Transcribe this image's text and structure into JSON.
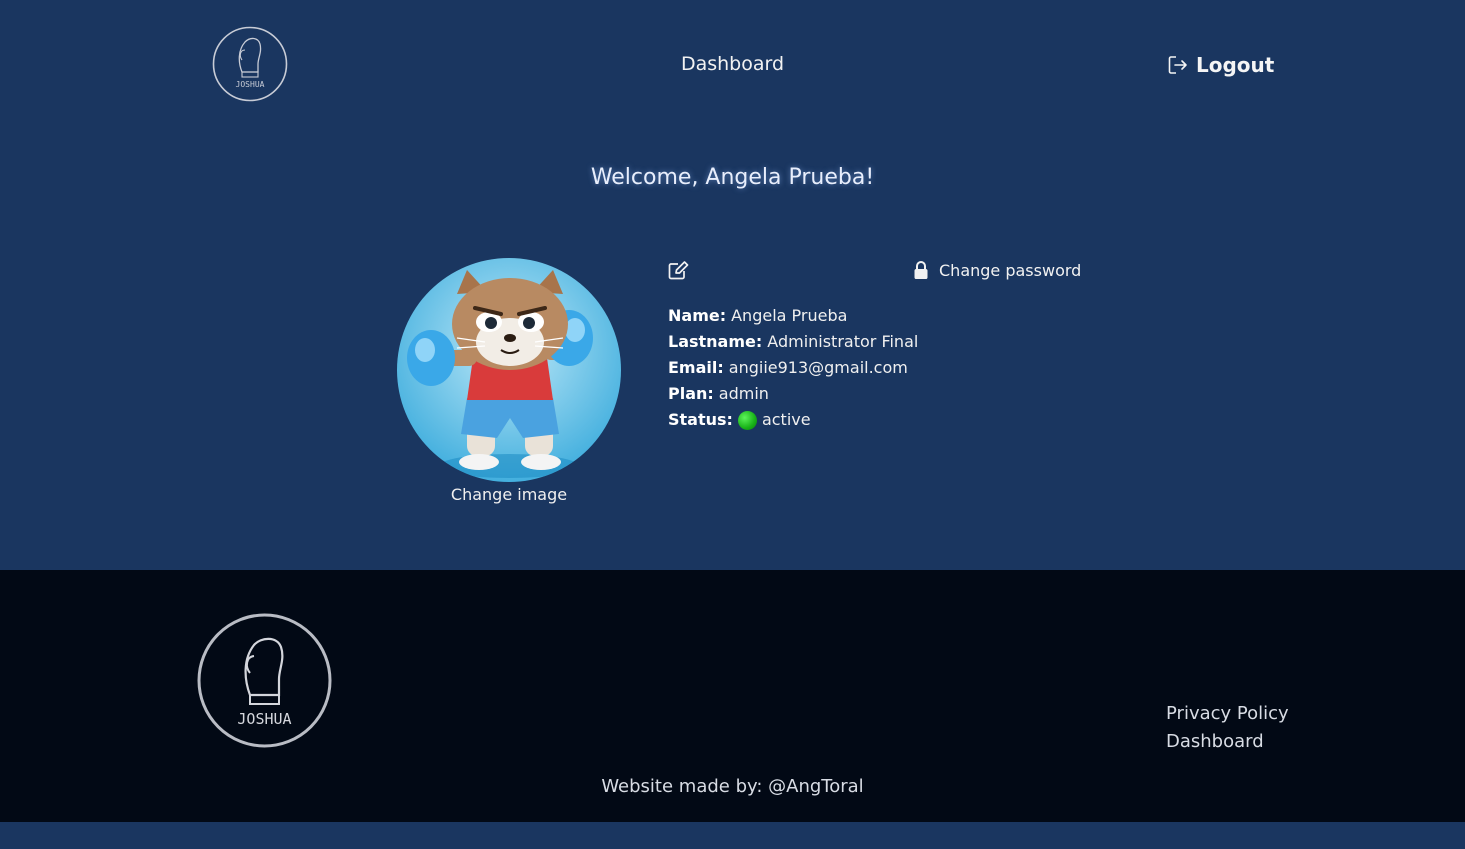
{
  "header": {
    "logo_icon": "boxing-glove-logo-icon",
    "logo_text": "JOSHUA",
    "nav_dashboard": "Dashboard",
    "logout_icon": "logout-icon",
    "logout_label": "Logout"
  },
  "welcome": "Welcome, Angela Prueba!",
  "profile": {
    "avatar_icon": "boxing-cat-avatar-image",
    "change_image": "Change image",
    "edit_icon": "edit-icon",
    "lock_icon": "lock-icon",
    "change_password": "Change password",
    "fields": {
      "name_label": "Name:",
      "name": "Angela Prueba",
      "lastname_label": "Lastname:",
      "lastname": "Administrator Final",
      "email_label": "Email:",
      "email": "angiie913@gmail.com",
      "plan_label": "Plan:",
      "plan": "admin",
      "status_label": "Status:",
      "status": "active"
    }
  },
  "footer": {
    "logo_icon": "boxing-glove-logo-icon",
    "logo_text": "JOSHUA",
    "privacy_policy": "Privacy Policy",
    "dashboard": "Dashboard",
    "credits_label": "Website made by:",
    "credits_handle": "@AngToral"
  },
  "colors": {
    "page_bg": "#1a3660",
    "footer_bg": "#020915",
    "status_active": "#1fc21f"
  }
}
